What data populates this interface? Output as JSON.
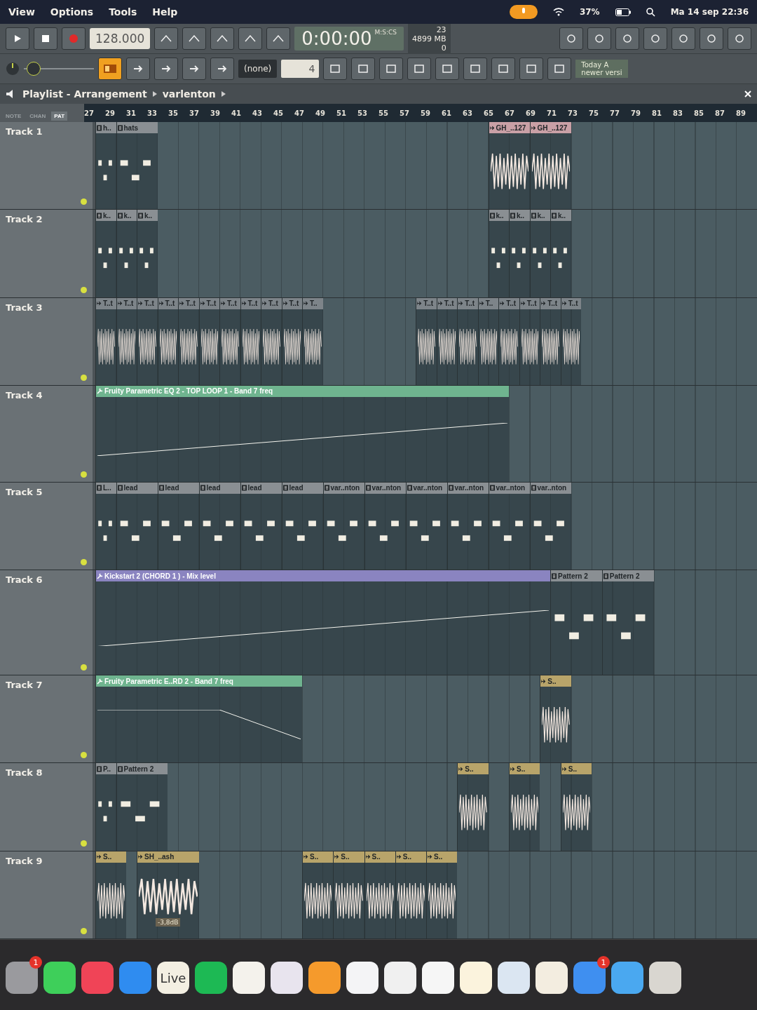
{
  "menu_bar": {
    "items": [
      "View",
      "Options",
      "Tools",
      "Help"
    ],
    "battery": "37%",
    "clock": "Ma 14 sep 22:36"
  },
  "transport": {
    "master_volume": {
      "level": 0.05
    },
    "tempo": "128.000",
    "time": "0:00:00",
    "time_format": "M:S:CS",
    "cpu": "23",
    "memory": "4899 MB",
    "polyphony": "0",
    "pattern_select": "(none)",
    "snap_value": "4",
    "news_line_1": "Today A",
    "news_line_2": "newer versi"
  },
  "playlist": {
    "title": "Playlist - Arrangement",
    "pattern": "varlenton",
    "picker_tabs": [
      {
        "label": "NOTE",
        "selected": false
      },
      {
        "label": "CHAN",
        "selected": false
      },
      {
        "label": "PAT",
        "selected": true
      }
    ],
    "ruler": [
      "27",
      "29",
      "31",
      "33",
      "35",
      "37",
      "39",
      "41",
      "43",
      "45",
      "47",
      "49",
      "51",
      "53",
      "55",
      "57",
      "59",
      "61",
      "63",
      "65",
      "67",
      "69",
      "71",
      "73",
      "75",
      "77",
      "79",
      "81",
      "83",
      "85",
      "87",
      "89"
    ],
    "tracks": [
      {
        "name": "Track 1",
        "clips": [
          {
            "kind": "pattern",
            "label": "h..",
            "color": "#8a8f93"
          },
          {
            "kind": "pattern",
            "label": "hats",
            "color": "#8a8f93"
          },
          {
            "kind": "audio",
            "label": "GH_..127",
            "color": "#c9a0a6"
          },
          {
            "kind": "audio",
            "label": "GH_..127",
            "color": "#c9a0a6"
          }
        ]
      },
      {
        "name": "Track 2",
        "clips": [
          {
            "kind": "pattern",
            "label": "k..",
            "color": "#8a8f93"
          },
          {
            "kind": "pattern",
            "label": "k..",
            "color": "#8a8f93"
          },
          {
            "kind": "pattern",
            "label": "k..",
            "color": "#8a8f93"
          },
          {
            "kind": "pattern",
            "label": "k..",
            "color": "#8a8f93"
          },
          {
            "kind": "pattern",
            "label": "k..",
            "color": "#8a8f93"
          },
          {
            "kind": "pattern",
            "label": "k..",
            "color": "#8a8f93"
          },
          {
            "kind": "pattern",
            "label": "k..",
            "color": "#8a8f93"
          }
        ]
      },
      {
        "name": "Track 3",
        "clips": [
          {
            "kind": "audio",
            "label": "T..t",
            "color": "#7d8489"
          },
          {
            "kind": "audio",
            "label": "T..t",
            "color": "#7d8489"
          },
          {
            "kind": "audio",
            "label": "T..t",
            "color": "#7d8489"
          },
          {
            "kind": "audio",
            "label": "T..t",
            "color": "#7d8489"
          },
          {
            "kind": "audio",
            "label": "T..t",
            "color": "#7d8489"
          },
          {
            "kind": "audio",
            "label": "T..t",
            "color": "#7d8489"
          },
          {
            "kind": "audio",
            "label": "T..t",
            "color": "#7d8489"
          },
          {
            "kind": "audio",
            "label": "T..t",
            "color": "#7d8489"
          },
          {
            "kind": "audio",
            "label": "T..t",
            "color": "#7d8489"
          },
          {
            "kind": "audio",
            "label": "T..t",
            "color": "#7d8489"
          },
          {
            "kind": "audio",
            "label": "T..",
            "color": "#7d8489"
          },
          {
            "kind": "audio",
            "label": "T..t",
            "color": "#7d8489"
          },
          {
            "kind": "audio",
            "label": "T..t",
            "color": "#7d8489"
          },
          {
            "kind": "audio",
            "label": "T..t",
            "color": "#7d8489"
          },
          {
            "kind": "audio",
            "label": "T..",
            "color": "#7d8489"
          },
          {
            "kind": "audio",
            "label": "T..t",
            "color": "#7d8489"
          },
          {
            "kind": "audio",
            "label": "T..t",
            "color": "#7d8489"
          },
          {
            "kind": "audio",
            "label": "T..t",
            "color": "#7d8489"
          },
          {
            "kind": "audio",
            "label": "T..t",
            "color": "#7d8489"
          }
        ]
      },
      {
        "name": "Track 4",
        "clips": [
          {
            "kind": "automation",
            "label": "Fruity Parametric EQ 2 - TOP LOOP 1  - Band 7 freq",
            "color": "#6fb48f"
          }
        ]
      },
      {
        "name": "Track 5",
        "clips": [
          {
            "kind": "pattern",
            "label": "L..",
            "color": "#8a8f93"
          },
          {
            "kind": "pattern",
            "label": "lead",
            "color": "#8a8f93"
          },
          {
            "kind": "pattern",
            "label": "lead",
            "color": "#8a8f93"
          },
          {
            "kind": "pattern",
            "label": "lead",
            "color": "#8a8f93"
          },
          {
            "kind": "pattern",
            "label": "lead",
            "color": "#8a8f93"
          },
          {
            "kind": "pattern",
            "label": "lead",
            "color": "#8a8f93"
          },
          {
            "kind": "pattern",
            "label": "var..nton",
            "color": "#8a8f93"
          },
          {
            "kind": "pattern",
            "label": "var..nton",
            "color": "#8a8f93"
          },
          {
            "kind": "pattern",
            "label": "var..nton",
            "color": "#8a8f93"
          },
          {
            "kind": "pattern",
            "label": "var..nton",
            "color": "#8a8f93"
          },
          {
            "kind": "pattern",
            "label": "var..nton",
            "color": "#8a8f93"
          },
          {
            "kind": "pattern",
            "label": "var..nton",
            "color": "#8a8f93"
          }
        ]
      },
      {
        "name": "Track 6",
        "clips": [
          {
            "kind": "automation",
            "label": "Kickstart 2 (CHORD 1 ) - Mix level",
            "color": "#8a84c0"
          },
          {
            "kind": "pattern",
            "label": "Pattern 2",
            "color": "#8a8f93"
          },
          {
            "kind": "pattern",
            "label": "Pattern 2",
            "color": "#8a8f93"
          }
        ]
      },
      {
        "name": "Track 7",
        "clips": [
          {
            "kind": "automation",
            "label": "Fruity Parametric E..RD 2  - Band 7 freq",
            "color": "#6fb48f"
          },
          {
            "kind": "audio",
            "label": "S..",
            "color": "#b8a46a"
          }
        ]
      },
      {
        "name": "Track 8",
        "clips": [
          {
            "kind": "pattern",
            "label": "P..",
            "color": "#8a8f93"
          },
          {
            "kind": "pattern",
            "label": "Pattern 2",
            "color": "#8a8f93"
          },
          {
            "kind": "audio",
            "label": "S..",
            "color": "#b8a46a"
          },
          {
            "kind": "audio",
            "label": "S..",
            "color": "#b8a46a"
          },
          {
            "kind": "audio",
            "label": "S..",
            "color": "#b8a46a"
          }
        ]
      },
      {
        "name": "Track 9",
        "clips": [
          {
            "kind": "audio",
            "label": "S..",
            "color": "#b8a46a"
          },
          {
            "kind": "audio",
            "label": "SH_..ash",
            "color": "#b8a46a",
            "gain": "-3,8dB"
          },
          {
            "kind": "audio",
            "label": "S..",
            "color": "#b8a46a"
          },
          {
            "kind": "audio",
            "label": "S..",
            "color": "#b8a46a"
          },
          {
            "kind": "audio",
            "label": "S..",
            "color": "#b8a46a"
          },
          {
            "kind": "audio",
            "label": "S..",
            "color": "#b8a46a"
          },
          {
            "kind": "audio",
            "label": "S..",
            "color": "#b8a46a"
          }
        ]
      }
    ]
  },
  "dock": {
    "items": [
      {
        "kind": "settings",
        "badge": "1"
      },
      {
        "kind": "chat"
      },
      {
        "kind": "music"
      },
      {
        "kind": "store"
      },
      {
        "kind": "text",
        "label": "Live"
      },
      {
        "kind": "stream"
      },
      {
        "kind": "notes"
      },
      {
        "kind": "film"
      },
      {
        "kind": "fruit"
      },
      {
        "kind": "puzzle"
      },
      {
        "kind": "zip"
      },
      {
        "kind": "flower"
      },
      {
        "kind": "sheet"
      },
      {
        "kind": "camera"
      },
      {
        "kind": "bolt"
      },
      {
        "kind": "mail",
        "badge": "1"
      },
      {
        "kind": "compass"
      },
      {
        "kind": "trash"
      }
    ]
  }
}
